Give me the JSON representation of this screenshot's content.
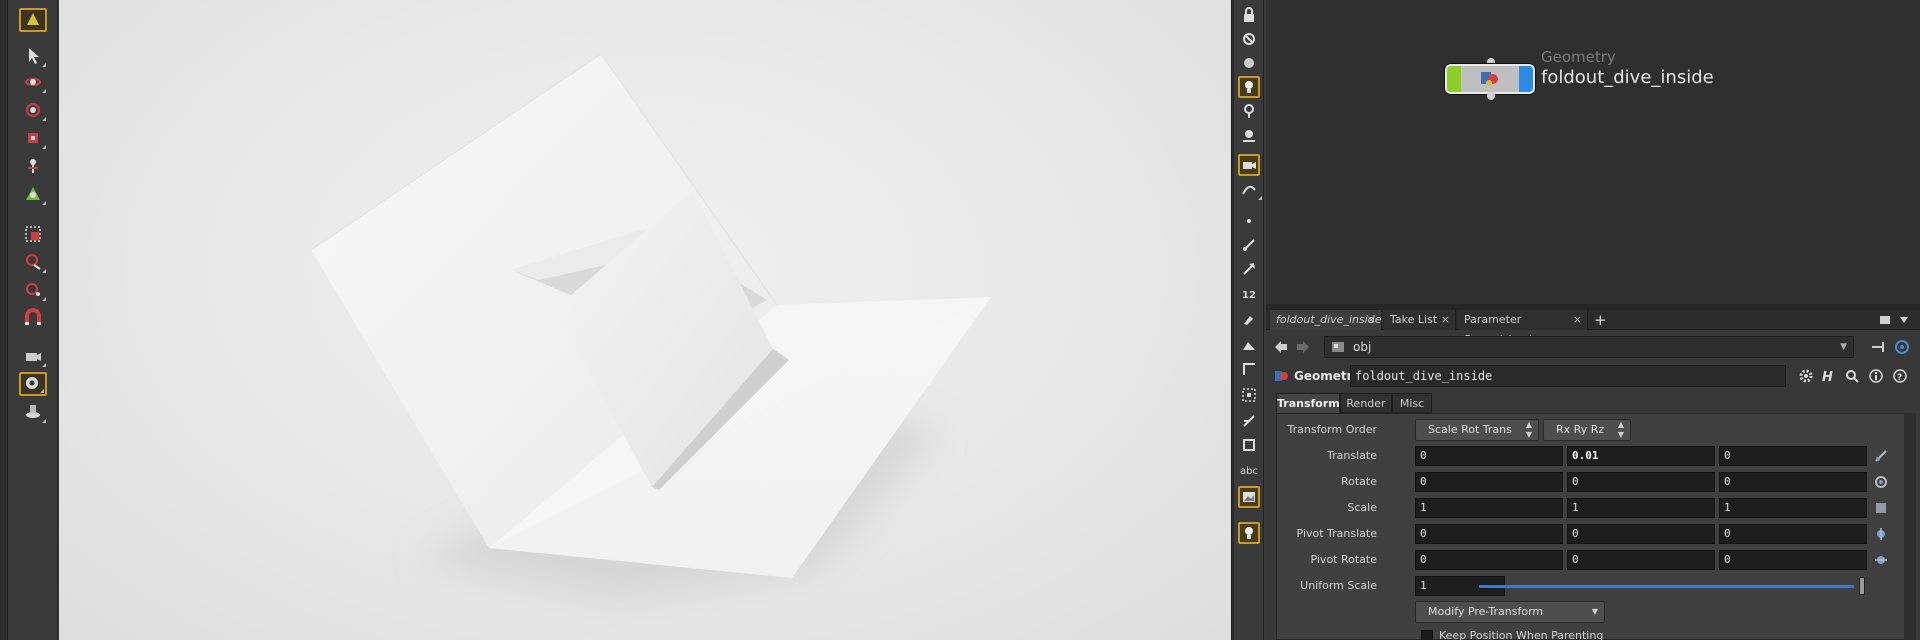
{
  "toolbar": {
    "tools": [
      {
        "name": "select-tool",
        "icon": "arrow-select-icon",
        "active": false
      },
      {
        "name": "move-tool",
        "icon": "move-icon",
        "active": false
      },
      {
        "name": "rotate-tool",
        "icon": "rotate-icon",
        "active": false
      },
      {
        "name": "scale-tool",
        "icon": "scale-icon",
        "active": false
      },
      {
        "name": "handle-tool",
        "icon": "handle-icon",
        "active": false
      },
      {
        "name": "pose-tool",
        "icon": "pose-icon",
        "active": false
      },
      {
        "name": "box-select-tool",
        "icon": "box-select-icon",
        "active": false
      },
      {
        "name": "lasso-tool",
        "icon": "lasso-icon",
        "active": false
      },
      {
        "name": "paint-tool",
        "icon": "paint-icon",
        "active": false
      },
      {
        "name": "magnet-tool",
        "icon": "magnet-icon",
        "active": false
      },
      {
        "name": "camera-tool",
        "icon": "camera-icon",
        "active": false
      },
      {
        "name": "view-tool",
        "icon": "view-icon",
        "active": true
      },
      {
        "name": "flipbook-tool",
        "icon": "flipbook-icon",
        "active": false
      }
    ]
  },
  "network": {
    "node": {
      "type": "Geometry",
      "name": "foldout_dive_inside",
      "flag_left_color": "#8ccd27",
      "flag_right_color": "#2d8ae3"
    }
  },
  "vshelf": {
    "abc_label": "abc",
    "digit_label": "12"
  },
  "params": {
    "tabs": [
      {
        "label": "foldout_dive_inside",
        "close": "×"
      },
      {
        "label": "Take List",
        "close": "×"
      },
      {
        "label": "Parameter Spreadsheet",
        "close": "×"
      }
    ],
    "add_tab": "+",
    "path": "obj",
    "node_type": "Geometry",
    "node_name": "foldout_dive_inside",
    "subtabs": [
      "Transform",
      "Render",
      "Misc"
    ],
    "transform_order": {
      "label": "Transform Order",
      "order": "Scale Rot Trans",
      "rot": "Rx Ry Rz"
    },
    "translate": {
      "label": "Translate",
      "x": "0",
      "y": "0.01",
      "z": "0"
    },
    "rotate": {
      "label": "Rotate",
      "x": "0",
      "y": "0",
      "z": "0"
    },
    "scale": {
      "label": "Scale",
      "x": "1",
      "y": "1",
      "z": "1"
    },
    "pivot_translate": {
      "label": "Pivot Translate",
      "x": "0",
      "y": "0",
      "z": "0"
    },
    "pivot_rotate": {
      "label": "Pivot Rotate",
      "x": "0",
      "y": "0",
      "z": "0"
    },
    "uniform_scale": {
      "label": "Uniform Scale",
      "value": "1"
    },
    "modify_menu": "Modify Pre-Transform",
    "keep_position": "Keep Position When Parenting"
  }
}
